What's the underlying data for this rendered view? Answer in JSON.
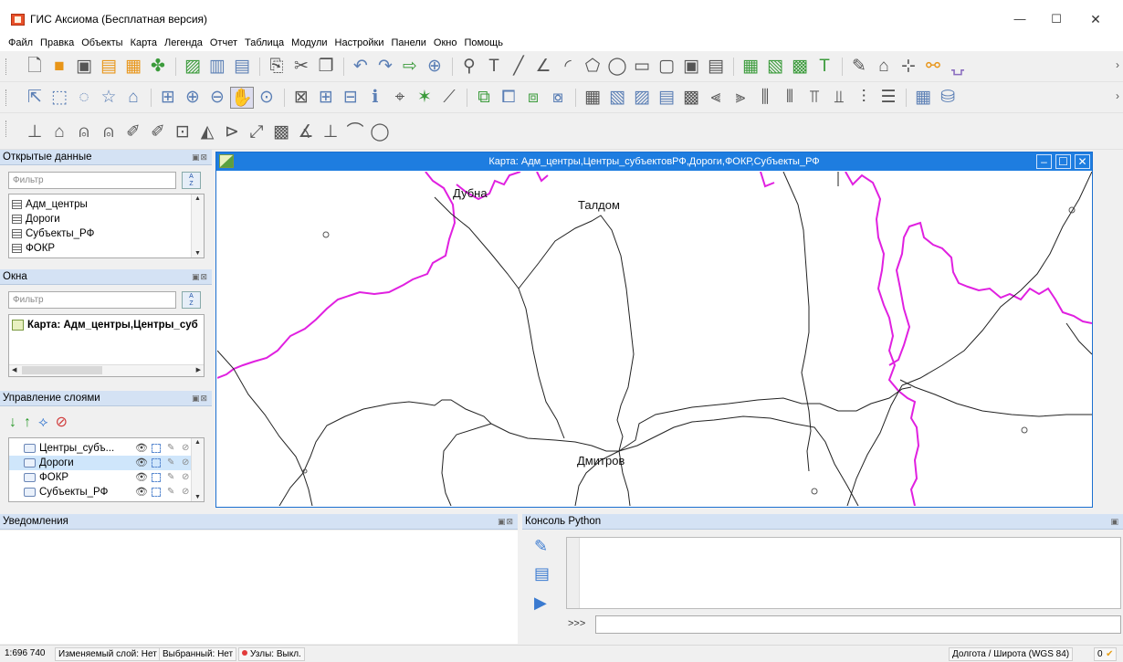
{
  "app": {
    "title": "ГИС Аксиома (Бесплатная версия)"
  },
  "window_controls": {
    "minimize": "—",
    "maximize": "☐",
    "close": "✕"
  },
  "menu": [
    "Файл",
    "Правка",
    "Объекты",
    "Карта",
    "Легенда",
    "Отчет",
    "Таблица",
    "Модули",
    "Настройки",
    "Панели",
    "Окно",
    "Помощь"
  ],
  "toolbar_more": "›",
  "panels": {
    "open_data": {
      "header": "Открытые данные",
      "filter_placeholder": "Фильтр",
      "items": [
        "Адм_центры",
        "Дороги",
        "Субъекты_РФ",
        "ФОКР"
      ]
    },
    "windows": {
      "header": "Окна",
      "filter_placeholder": "Фильтр",
      "items": [
        "Карта: Адм_центры,Центры_суб"
      ]
    },
    "layers": {
      "header": "Управление слоями",
      "rows": [
        "Центры_субъ...",
        "Дороги",
        "ФОКР",
        "Субъекты_РФ"
      ],
      "selected_index": 1
    },
    "notifications": {
      "header": "Уведомления"
    },
    "python_console": {
      "header": "Консоль Python",
      "prompt": ">>>"
    }
  },
  "map": {
    "title": "Карта: Адм_центры,Центры_субъектовРФ,Дороги,ФОКР,Субъекты_РФ",
    "cities": [
      "Дубна",
      "Талдом",
      "Дмитров"
    ],
    "colors": {
      "boundary": "#e020e0",
      "road": "#222222",
      "titlebar": "#1e7de0"
    }
  },
  "status": {
    "scale": "1:696 740",
    "edit_layer": "Изменяемый слой: Нет",
    "selected": "Выбранный: Нет",
    "nodes": "Узлы: Выкл.",
    "coords": "Долгота / Широта (WGS 84)",
    "count": "0"
  }
}
